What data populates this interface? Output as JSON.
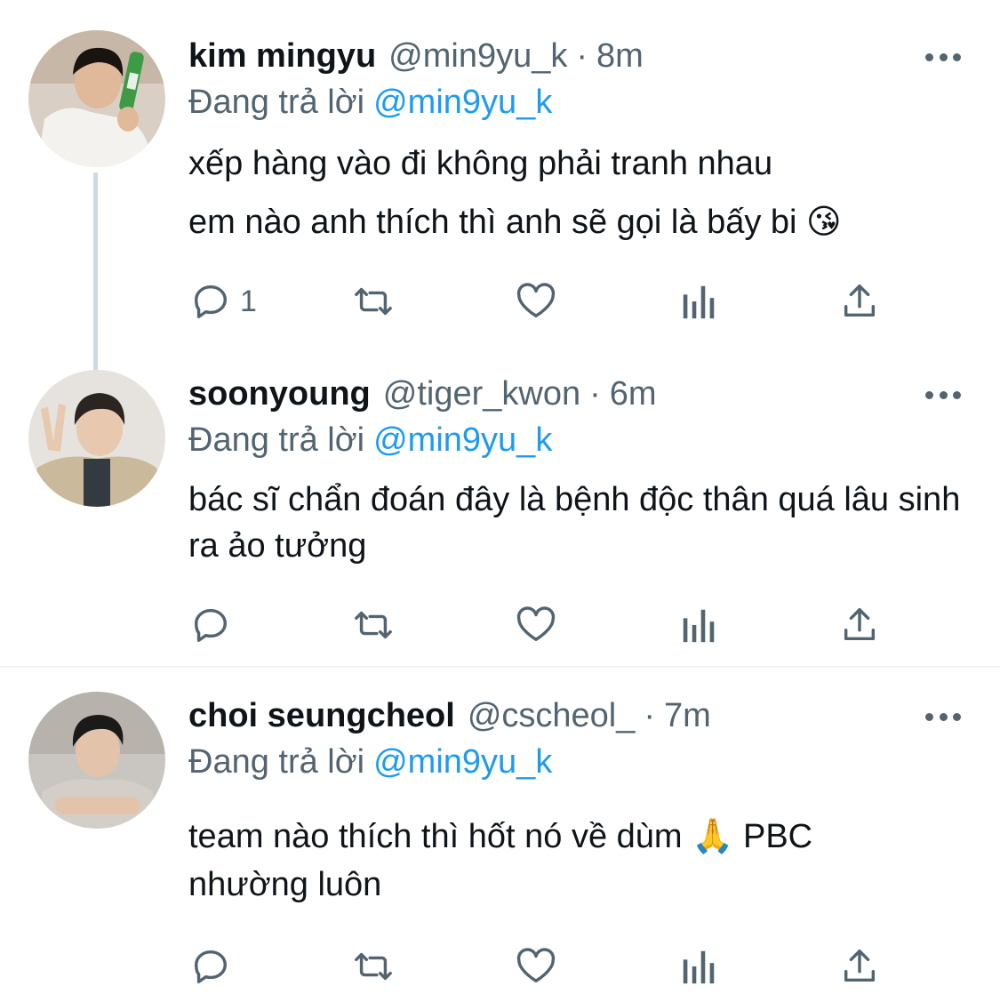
{
  "tweets": [
    {
      "name": "kim mingyu",
      "handle": "@min9yu_k",
      "dot": "·",
      "time": "8m",
      "reply_prefix": "Đang trả lời",
      "reply_to": "@min9yu_k",
      "lines": [
        "xếp hàng vào đi không phải tranh nhau",
        "em nào anh thích thì anh sẽ gọi là bấy bi 😘"
      ],
      "reply_count": "1",
      "avatar_colors": {
        "bg": "#d9cfc4",
        "shirt": "#f4f2ee",
        "hair": "#1a1410",
        "skin": "#e0b89a",
        "bottle": "#3d9a45"
      }
    },
    {
      "name": "soonyoung",
      "handle": "@tiger_kwon",
      "dot": "·",
      "time": "6m",
      "reply_prefix": "Đang trả lời",
      "reply_to": "@min9yu_k",
      "lines": [
        "bác sĩ chẩn đoán đây là bệnh độc thân quá lâu sinh ra ảo tưởng"
      ],
      "reply_count": "",
      "avatar_colors": {
        "bg": "#e6e3de",
        "shirt": "#cbb99b",
        "hair": "#2a2520",
        "skin": "#e8c8ae"
      }
    },
    {
      "name": "choi seungcheol",
      "handle": "@cscheol_",
      "dot": "·",
      "time": "7m",
      "reply_prefix": "Đang trả lời",
      "reply_to": "@min9yu_k",
      "lines": [
        "team nào thích thì hốt nó về dùm 🙏  PBC nhường luôn"
      ],
      "reply_count": "",
      "avatar_colors": {
        "bg": "#c9c6c2",
        "shirt": "#d3cfc8",
        "hair": "#1c1a18",
        "skin": "#e3c4ab"
      }
    }
  ],
  "icons": {
    "reply": "reply-icon",
    "retweet": "retweet-icon",
    "like": "heart-icon",
    "views": "views-icon",
    "share": "share-icon",
    "more": "more-icon"
  },
  "colors": {
    "text": "#0f1419",
    "secondary": "#536471",
    "link": "#1d9bf0",
    "line": "#cfd9de",
    "divider": "#eff3f4"
  }
}
